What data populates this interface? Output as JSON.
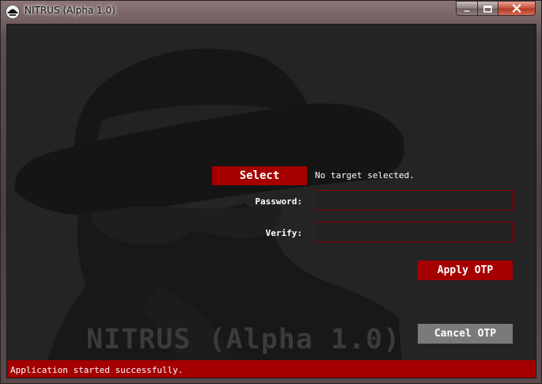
{
  "window": {
    "title": "NITRUS (Alpha 1.0)"
  },
  "main": {
    "select_label": "Select",
    "target_status": "No target selected.",
    "password_label": "Password:",
    "password_value": "",
    "verify_label": "Verify:",
    "verify_value": "",
    "apply_label": "Apply OTP",
    "cancel_label": "Cancel OTP",
    "watermark": "NITRUS (Alpha 1.0)"
  },
  "status_bar": {
    "message": "Application started successfully."
  },
  "colors": {
    "accent_red": "#a40000",
    "field_border": "#8a0000",
    "background": "#242424",
    "disabled_gray": "#7a7a7a"
  },
  "icons": {
    "app": "spy-hat-icon",
    "minimize": "minimize-icon",
    "maximize": "maximize-icon",
    "close": "close-icon"
  }
}
